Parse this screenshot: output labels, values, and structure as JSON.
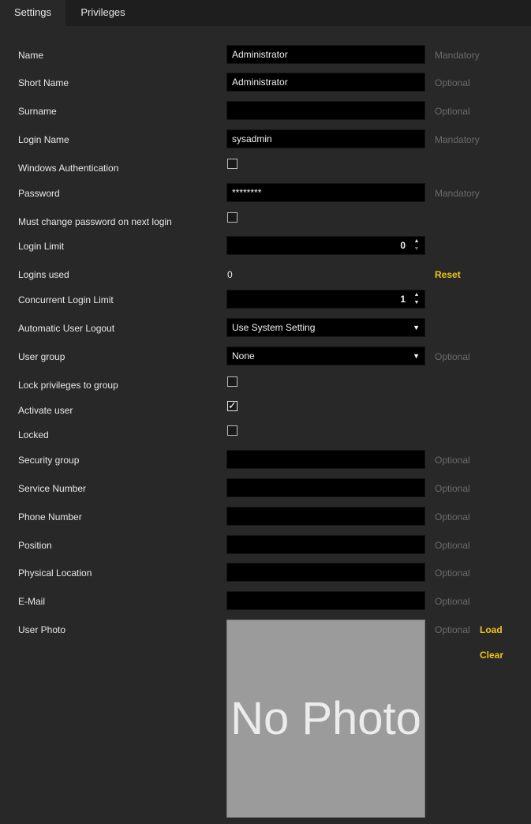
{
  "tabs": [
    "Settings",
    "Privileges"
  ],
  "form": {
    "name": {
      "label": "Name",
      "value": "Administrator",
      "hint": "Mandatory"
    },
    "short_name": {
      "label": "Short Name",
      "value": "Administrator",
      "hint": "Optional"
    },
    "surname": {
      "label": "Surname",
      "value": "",
      "hint": "Optional"
    },
    "login_name": {
      "label": "Login Name",
      "value": "sysadmin",
      "hint": "Mandatory"
    },
    "windows_auth": {
      "label": "Windows Authentication",
      "checked": false
    },
    "password": {
      "label": "Password",
      "value": "********",
      "hint": "Mandatory"
    },
    "must_change": {
      "label": "Must change password on next login",
      "checked": false
    },
    "login_limit": {
      "label": "Login Limit",
      "value": "0"
    },
    "logins_used": {
      "label": "Logins used",
      "value": "0",
      "action": "Reset"
    },
    "concurrent_limit": {
      "label": "Concurrent Login Limit",
      "value": "1"
    },
    "auto_logout": {
      "label": "Automatic User Logout",
      "value": "Use System Setting"
    },
    "user_group": {
      "label": "User group",
      "value": "None",
      "hint": "Optional"
    },
    "lock_privileges": {
      "label": "Lock privileges to group",
      "checked": false
    },
    "activate_user": {
      "label": "Activate user",
      "checked": true
    },
    "locked": {
      "label": "Locked",
      "checked": false
    },
    "security_group": {
      "label": "Security group",
      "value": "",
      "hint": "Optional"
    },
    "service_number": {
      "label": "Service Number",
      "value": "",
      "hint": "Optional"
    },
    "phone_number": {
      "label": "Phone Number",
      "value": "",
      "hint": "Optional"
    },
    "position": {
      "label": "Position",
      "value": "",
      "hint": "Optional"
    },
    "physical_location": {
      "label": "Physical Location",
      "value": "",
      "hint": "Optional"
    },
    "email": {
      "label": "E-Mail",
      "value": "",
      "hint": "Optional"
    },
    "user_photo": {
      "label": "User Photo",
      "hint": "Optional",
      "load": "Load",
      "clear": "Clear",
      "placeholder": "No Photo"
    }
  },
  "icons": {
    "checkmark": "✓",
    "spin_up": "▲",
    "spin_down": "▼",
    "dropdown": "▼"
  },
  "colors": {
    "accent": "#f0c419",
    "background": "#282828",
    "field": "#000000",
    "hint": "#6b6b6b"
  }
}
